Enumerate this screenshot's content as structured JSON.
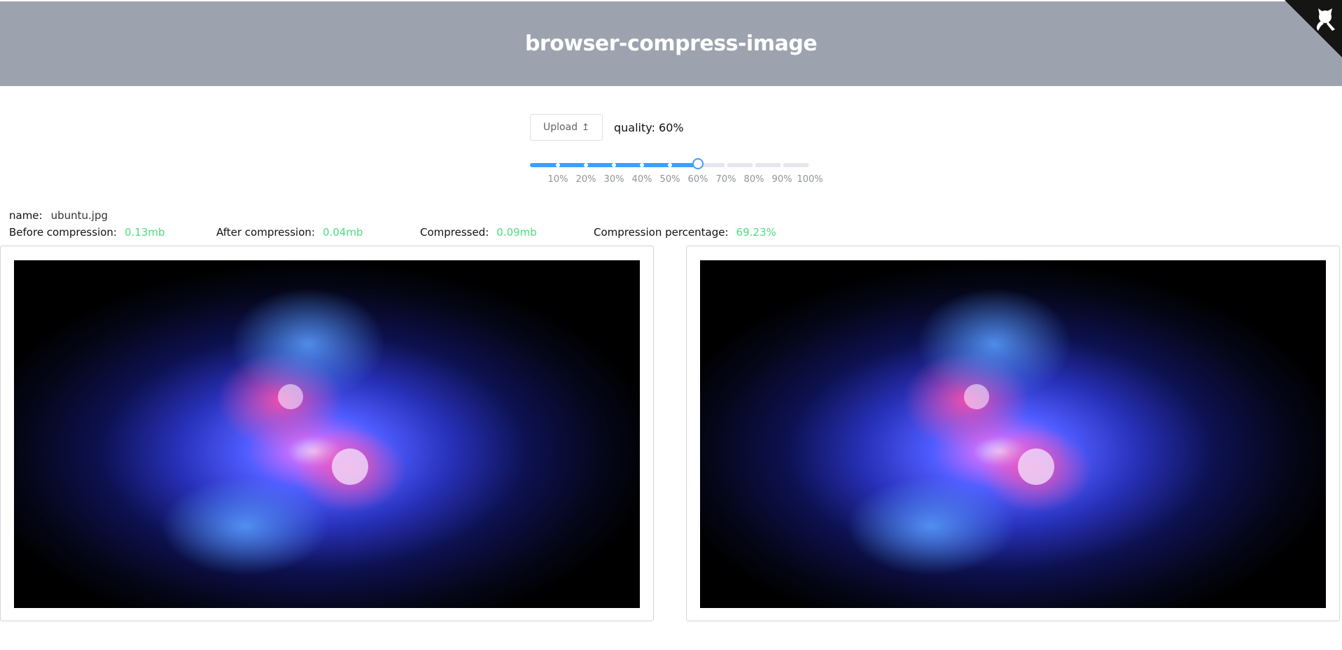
{
  "header": {
    "title": "browser-compress-image"
  },
  "corner": {
    "icon": "github-cat-icon"
  },
  "controls": {
    "upload_label": "Upload",
    "upload_icon": "upload-arrow-icon",
    "quality_text": "quality: 60%"
  },
  "slider": {
    "value_percent": 60,
    "marks": [
      "10%",
      "20%",
      "30%",
      "40%",
      "50%",
      "60%",
      "70%",
      "80%",
      "90%",
      "100%"
    ],
    "accent": "#409eff"
  },
  "info": {
    "name_label": "name:",
    "name_value": "ubuntu.jpg",
    "before_label": "Before compression:",
    "before_value": "0.13mb",
    "after_label": "After compression:",
    "after_value": "0.04mb",
    "compressed_label": "Compressed:",
    "compressed_value": "0.09mb",
    "percentage_label": "Compression percentage:",
    "percentage_value": "69.23%",
    "value_color": "#4ade80"
  }
}
